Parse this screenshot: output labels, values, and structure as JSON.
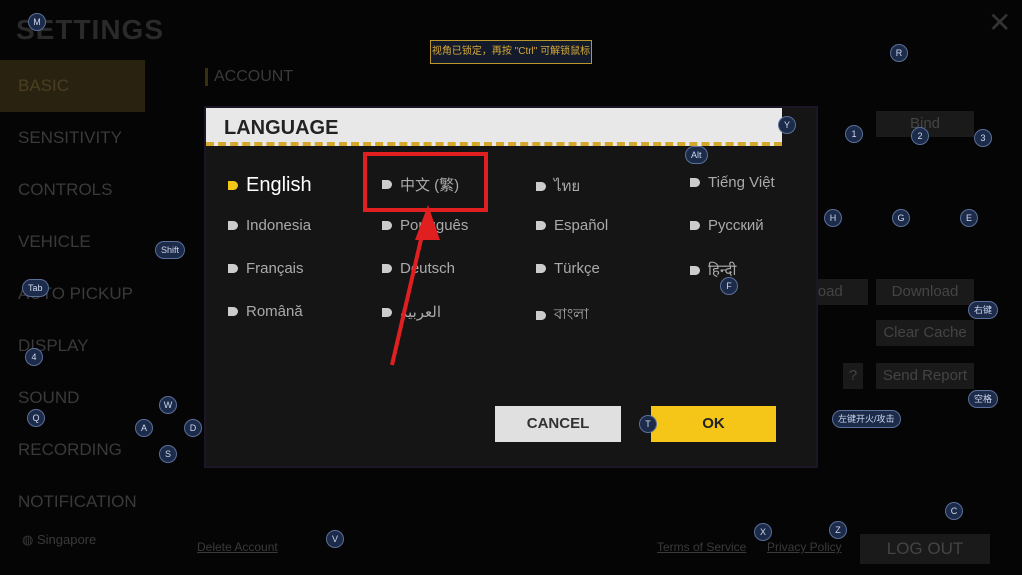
{
  "settings": {
    "title": "SETTINGS",
    "sidebar": [
      "BASIC",
      "SENSITIVITY",
      "CONTROLS",
      "VEHICLE",
      "AUTO PICKUP",
      "DISPLAY",
      "SOUND",
      "RECORDING",
      "NOTIFICATION"
    ],
    "region": "Singapore"
  },
  "background": {
    "section": "ACCOUNT",
    "bind": "Bind",
    "upload": "Upload",
    "download": "Download",
    "clear_cache": "Clear Cache",
    "help": "?",
    "send_report": "Send Report",
    "delete_account": "Delete Account",
    "terms": "Terms of Service",
    "privacy": "Privacy Policy",
    "logout": "LOG OUT"
  },
  "hint": "视角已锁定，再按 \"Ctrl\" 可解锁鼠标",
  "modal": {
    "title": "LANGUAGE",
    "languages": [
      "English",
      "中文 (繁)",
      "ไทย",
      "Tiếng Việt",
      "Indonesia",
      "Português",
      "Español",
      "Русский",
      "Français",
      "Deutsch",
      "Türkçe",
      "हिन्दी",
      "Română",
      "العربية",
      "বাংলা"
    ],
    "selected": "English",
    "cancel": "CANCEL",
    "ok": "OK"
  },
  "keys": [
    "M",
    "R",
    "Y",
    "Alt",
    "1",
    "2",
    "3",
    "H",
    "G",
    "E",
    "Shift",
    "Tab",
    "F",
    "4",
    "右键",
    "Q",
    "空格",
    "W",
    "A",
    "S",
    "D",
    "T",
    "左键开火/攻击",
    "C",
    "X",
    "Z",
    "V"
  ],
  "colors": {
    "accent": "#f5c518",
    "annotation": "#e02020"
  }
}
